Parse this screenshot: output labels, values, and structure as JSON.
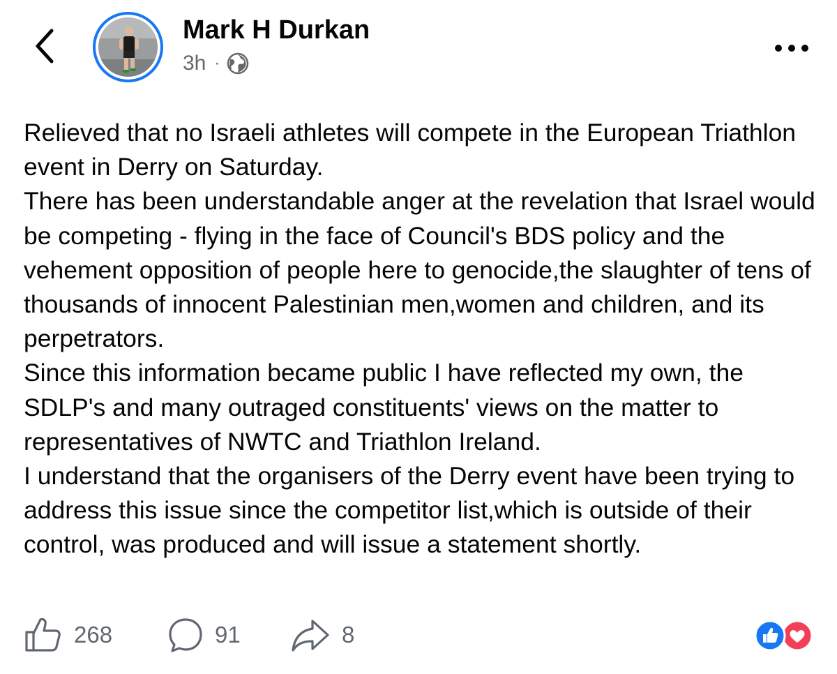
{
  "post": {
    "author": "Mark H Durkan",
    "time": "3h",
    "separator": "·",
    "body": [
      "Relieved that no Israeli athletes will compete in the European Triathlon event in Derry on Saturday.",
      "There has been understandable anger at the revelation that Israel would be competing - flying in the face of Council's BDS policy and the vehement opposition of people here to genocide,the slaughter of tens of thousands of innocent Palestinian men,women and children, and its perpetrators.",
      "Since this information became public I have reflected my own, the SDLP's and many outraged constituents' views on the matter to representatives of NWTC and Triathlon Ireland.",
      "I understand that the organisers of the Derry event have been trying to address this issue since the competitor list,which is outside of their control, was produced and will issue a statement shortly."
    ]
  },
  "actions": {
    "likes": "268",
    "comments": "91",
    "shares": "8"
  },
  "icons": {
    "back": "chevron-left-icon",
    "privacy": "globe-icon",
    "more": "more-horizontal-icon",
    "like": "thumbs-up-icon",
    "comment": "comment-bubble-icon",
    "share": "share-arrow-icon",
    "reactions": [
      "like-reaction-icon",
      "love-reaction-icon"
    ]
  },
  "colors": {
    "accent": "#1877f2",
    "love": "#f33e58",
    "secondary_text": "#65676b",
    "primary_text": "#050505"
  }
}
